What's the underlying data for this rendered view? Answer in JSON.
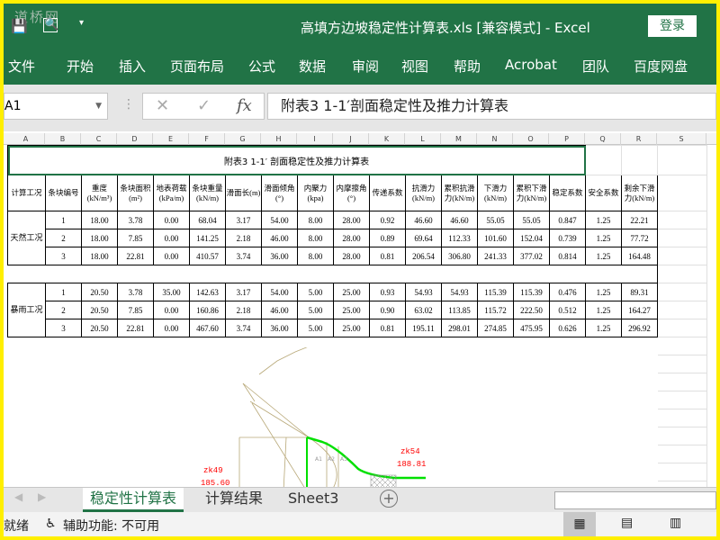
{
  "window": {
    "title": "高填方边坡稳定性计算表.xls  [兼容模式]  -  Excel",
    "login": "登录",
    "watermark": "道桥网",
    "qa_more": "▾"
  },
  "ribbon": {
    "tabs": [
      "文件",
      "开始",
      "插入",
      "页面布局",
      "公式",
      "数据",
      "审阅",
      "视图",
      "帮助",
      "Acrobat",
      "团队",
      "百度网盘"
    ]
  },
  "formula_bar": {
    "name_box": "A1",
    "cancel": "✕",
    "enter": "✓",
    "fx": "fx",
    "content": "附表3  1-1′剖面稳定性及推力计算表"
  },
  "columns": [
    "A",
    "B",
    "C",
    "D",
    "E",
    "F",
    "G",
    "H",
    "I",
    "J",
    "K",
    "L",
    "M",
    "N",
    "O",
    "P",
    "Q",
    "R",
    "S"
  ],
  "sheet": {
    "title": "附表3   1-1′ 剖面稳定性及推力计算表",
    "headers": [
      "计算工况",
      "条块编号",
      "重度(kN/m³)",
      "条块面积(m²)",
      "地表荷载(kPa/m)",
      "条块重量(kN/m)",
      "滑面长(m)",
      "滑面倾角(°)",
      "内聚力(kpa)",
      "内摩擦角(°)",
      "传递系数",
      "抗滑力(kN/m)",
      "累积抗滑力(kN/m)",
      "下滑力(kN/m)",
      "累积下滑力(kN/m)",
      "稳定系数",
      "安全系数",
      "剩余下滑力(kN/m)"
    ],
    "groups": [
      {
        "condition": "天然工况",
        "rows": [
          [
            "1",
            "18.00",
            "3.78",
            "0.00",
            "68.04",
            "3.17",
            "54.00",
            "8.00",
            "28.00",
            "0.92",
            "46.60",
            "46.60",
            "55.05",
            "55.05",
            "0.847",
            "1.25",
            "22.21"
          ],
          [
            "2",
            "18.00",
            "7.85",
            "0.00",
            "141.25",
            "2.18",
            "46.00",
            "8.00",
            "28.00",
            "0.89",
            "69.64",
            "112.33",
            "101.60",
            "152.04",
            "0.739",
            "1.25",
            "77.72"
          ],
          [
            "3",
            "18.00",
            "22.81",
            "0.00",
            "410.57",
            "3.74",
            "36.00",
            "8.00",
            "28.00",
            "0.81",
            "206.54",
            "306.80",
            "241.33",
            "377.02",
            "0.814",
            "1.25",
            "164.48"
          ]
        ]
      },
      {
        "condition": "暴雨工况",
        "rows": [
          [
            "1",
            "20.50",
            "3.78",
            "35.00",
            "142.63",
            "3.17",
            "54.00",
            "5.00",
            "25.00",
            "0.93",
            "54.93",
            "54.93",
            "115.39",
            "115.39",
            "0.476",
            "1.25",
            "89.31"
          ],
          [
            "2",
            "20.50",
            "7.85",
            "0.00",
            "160.86",
            "2.18",
            "46.00",
            "5.00",
            "25.00",
            "0.90",
            "63.02",
            "113.85",
            "115.72",
            "222.50",
            "0.512",
            "1.25",
            "164.27"
          ],
          [
            "3",
            "20.50",
            "22.81",
            "0.00",
            "467.60",
            "3.74",
            "36.00",
            "5.00",
            "25.00",
            "0.81",
            "195.11",
            "298.01",
            "274.85",
            "475.95",
            "0.626",
            "1.25",
            "296.92"
          ]
        ]
      }
    ]
  },
  "drawing": {
    "labels": [
      {
        "name": "zk49",
        "elev": "185.60"
      },
      {
        "name": "zk54",
        "elev": "188.81"
      }
    ],
    "slices": [
      "A1",
      "A2",
      "A3"
    ]
  },
  "sheet_tabs": [
    "稳定性计算表",
    "计算结果",
    "Sheet3"
  ],
  "status": {
    "ready": "就绪",
    "accessibility": "辅助功能: 不可用"
  },
  "colors": {
    "excel_green": "#217346",
    "frame": "#ffef00",
    "slope_line": "#00e000",
    "label_red": "#ff0000"
  }
}
